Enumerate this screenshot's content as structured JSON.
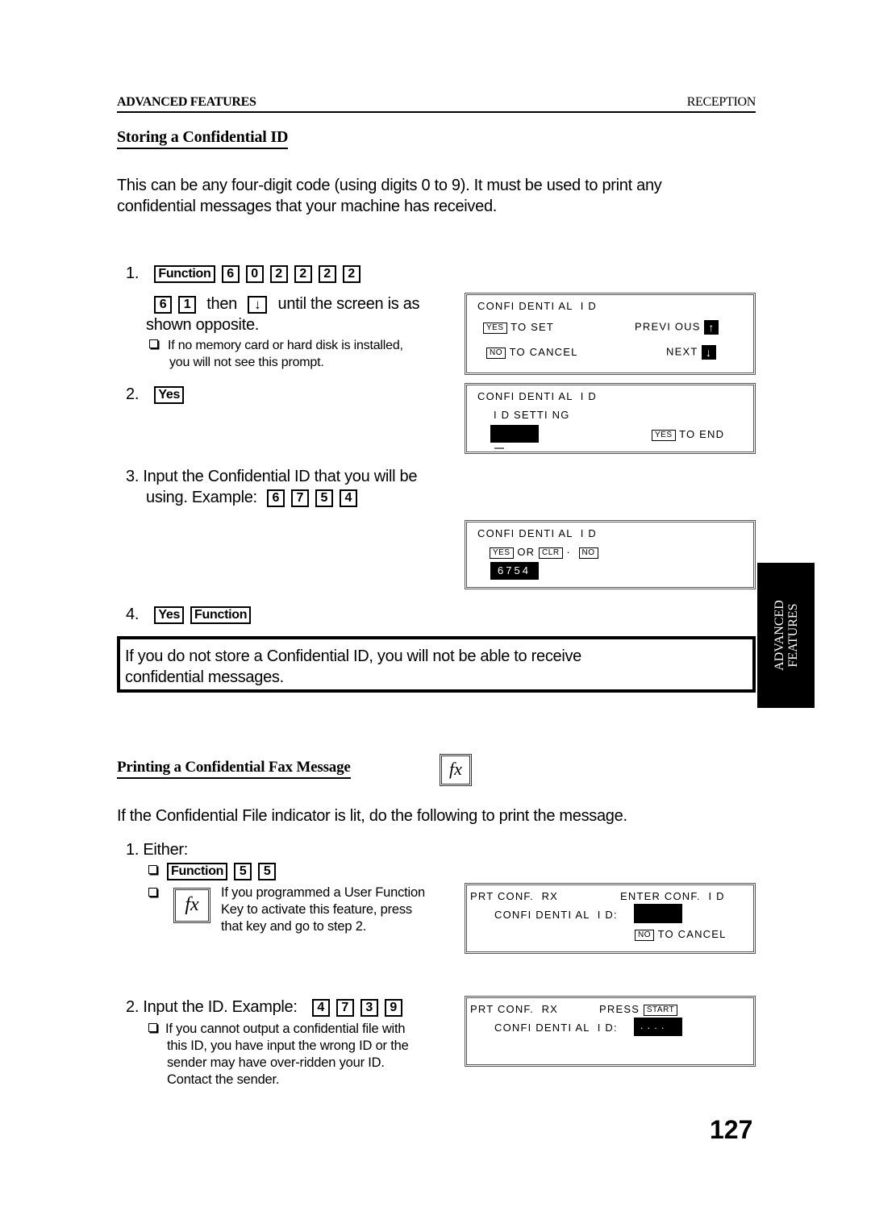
{
  "running_header": {
    "left": "ADVANCED FEATURES",
    "right": "RECEPTION"
  },
  "section1": {
    "title": "Storing a Confidential ID",
    "intro_line1": "This can be any four-digit code (using digits 0 to 9). It must be used to print any",
    "intro_line2": "confidential messages that your machine has received.",
    "step1": {
      "number": "1.",
      "keys": [
        "Function",
        "6",
        "0",
        "2",
        "2",
        "2",
        "2"
      ],
      "keys2": [
        "6",
        "1"
      ],
      "then_text": "then",
      "arrow_key": "↓",
      "after_text": "until the screen is as",
      "line2": "shown opposite.",
      "note_line1": "If no memory card or hard disk is installed,",
      "note_line2": "you will not see this prompt."
    },
    "step2": {
      "number": "2.",
      "keys": [
        "Yes"
      ]
    },
    "step3": {
      "line1": "3. Input the Confidential ID that you will be",
      "line2_prefix": "using.  Example:",
      "keys": [
        "6",
        "7",
        "5",
        "4"
      ]
    },
    "step4": {
      "number": "4.",
      "keys": [
        "Yes",
        "Function"
      ]
    },
    "warning_line1": "If you do not store a Confidential ID, you will not be able to receive",
    "warning_line2": "confidential messages."
  },
  "lcd_screens": {
    "screen1": {
      "title": "CONFI DENTI AL  I D",
      "yes_key": "YES",
      "yes_text": "TO SET",
      "prev_text": "PREVI OUS",
      "prev_arrow": "↑",
      "no_key": "NO",
      "no_text": "TO CANCEL",
      "next_text": "NEXT",
      "next_arrow": "↓"
    },
    "screen2": {
      "title": "CONFI DENTI AL  I D",
      "line2": "I D SETTI NG",
      "yes_key": "YES",
      "yes_text": "TO END"
    },
    "screen3": {
      "title": "CONFI DENTI AL  I D",
      "yes_key": "YES",
      "or_text": "OR",
      "clr_key": "CLR",
      "dot": "·",
      "no_key": "NO",
      "value": "6754"
    },
    "screen4": {
      "line1_left": "PRT CONF.  RX",
      "line1_right": "ENTER CONF.  I D",
      "line2": "CONFI DENTI AL  I D:",
      "no_key": "NO",
      "no_text": "TO CANCEL"
    },
    "screen5": {
      "line1_left": "PRT CONF.  RX",
      "line1_right": "PRESS",
      "start_key": "START",
      "line2": "CONFI DENTI AL  I D:",
      "value": ". . . ."
    }
  },
  "side_tab": {
    "line1": "ADVANCED",
    "line2": "FEATURES"
  },
  "section2": {
    "title": "Printing a Confidential Fax Message",
    "fx_icon": "fx",
    "intro": "If the Confidential File indicator is lit, do the following to print the message.",
    "step1": {
      "label": "1. Either:",
      "option1_keys": [
        "Function",
        "5",
        "5"
      ],
      "option2_line1": "If you programmed a User Function",
      "option2_line2": "Key to activate this feature, press",
      "option2_line3": "that key and go to step 2."
    },
    "step2": {
      "label": "2. Input the ID. Example:",
      "keys": [
        "4",
        "7",
        "3",
        "9"
      ],
      "note_line1": "If you cannot output a confidential file with",
      "note_line2": "this ID, you have input the wrong ID or the",
      "note_line3": "sender may have over-ridden your ID.",
      "note_line4": "Contact the sender."
    }
  },
  "page_number": "127"
}
